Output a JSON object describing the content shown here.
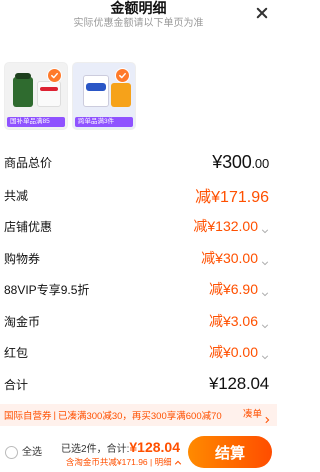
{
  "header": {
    "title": "金额明细",
    "subtitle": "实际优惠金额请以下单页为准"
  },
  "products": [
    {
      "tag": "国补单品满85"
    },
    {
      "tag": "跨单品满3件"
    }
  ],
  "rows": {
    "total_label": "商品总价",
    "total_value_main": "¥300",
    "total_value_dec": ".00",
    "reduce_label": "共减",
    "reduce_value": "减¥171.96",
    "shop_label": "店铺优惠",
    "shop_value": "减¥132.00",
    "coupon_label": "购物券",
    "coupon_value": "减¥30.00",
    "vip_label": "88VIP专享9.5折",
    "vip_value": "减¥6.90",
    "taojin_label": "淘金币",
    "taojin_value": "减¥3.06",
    "redpack_label": "红包",
    "redpack_value": "减¥0.00",
    "sum_label": "合计",
    "sum_value": "¥128.04"
  },
  "promo": {
    "text1": "国际自营券",
    "sep": "|",
    "text2": "已凑满300减30，再买300享满600减70",
    "cta": "凑单"
  },
  "bottom": {
    "select_all": "全选",
    "selected_count": "已选2件，",
    "total_label": "合计:",
    "total_value": "¥128.04",
    "coin_discount": "含淘金币共减¥171.96",
    "detail_link": "明细",
    "checkout": "结算"
  },
  "colors": {
    "accent": "#ff5000",
    "checkout_gradient_start": "#ff8a00",
    "checkout_gradient_end": "#ff4d00",
    "promo_bg": "#fff1ec",
    "product_tag": "#8f52ff"
  }
}
